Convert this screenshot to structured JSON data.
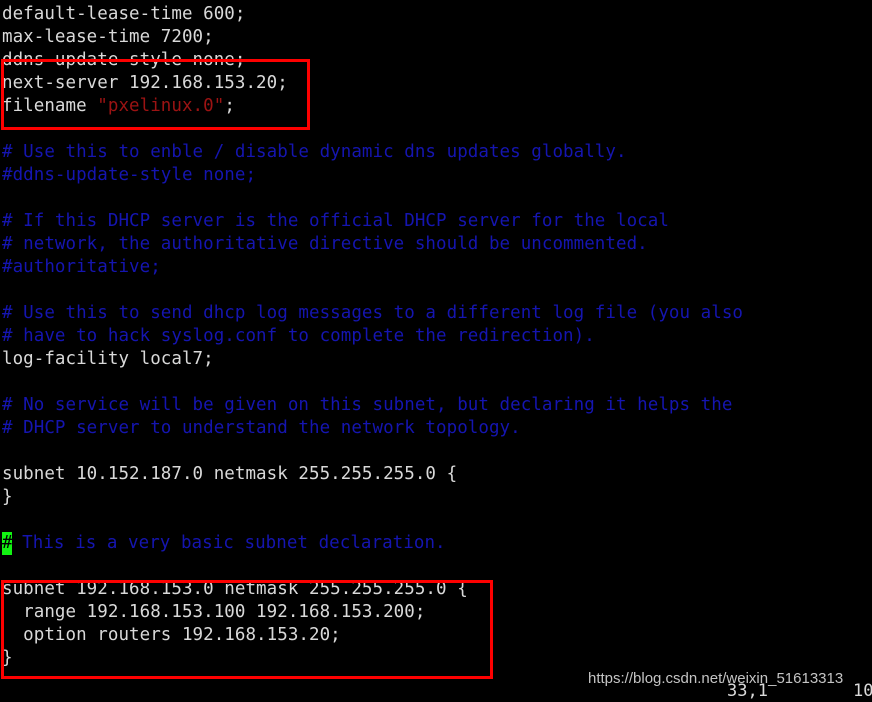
{
  "terminal": {
    "background": "#000000",
    "foreground": "#d9d9d9",
    "comment_color": "#1515b0",
    "string_color": "#9c1313",
    "cursor_color": "#12f312",
    "annotation_color": "#fe0000",
    "lines": [
      {
        "n": 1,
        "type": "code",
        "text": "default-lease-time 600;"
      },
      {
        "n": 2,
        "type": "code",
        "text": "max-lease-time 7200;"
      },
      {
        "n": 3,
        "type": "code",
        "text": "ddns-update-style none;"
      },
      {
        "n": 4,
        "type": "code",
        "text": "next-server 192.168.153.20;"
      },
      {
        "n": 5,
        "type": "mixed",
        "prefix": "filename ",
        "string": "\"pxelinux.0\"",
        "suffix": ";"
      },
      {
        "n": 6,
        "type": "blank",
        "text": ""
      },
      {
        "n": 7,
        "type": "comment",
        "text": "# Use this to enble / disable dynamic dns updates globally."
      },
      {
        "n": 8,
        "type": "comment",
        "text": "#ddns-update-style none;"
      },
      {
        "n": 9,
        "type": "blank",
        "text": ""
      },
      {
        "n": 10,
        "type": "comment",
        "text": "# If this DHCP server is the official DHCP server for the local"
      },
      {
        "n": 11,
        "type": "comment",
        "text": "# network, the authoritative directive should be uncommented."
      },
      {
        "n": 12,
        "type": "comment",
        "text": "#authoritative;"
      },
      {
        "n": 13,
        "type": "blank",
        "text": ""
      },
      {
        "n": 14,
        "type": "comment",
        "text": "# Use this to send dhcp log messages to a different log file (you also"
      },
      {
        "n": 15,
        "type": "comment",
        "text": "# have to hack syslog.conf to complete the redirection)."
      },
      {
        "n": 16,
        "type": "code",
        "text": "log-facility local7;"
      },
      {
        "n": 17,
        "type": "blank",
        "text": ""
      },
      {
        "n": 18,
        "type": "comment",
        "text": "# No service will be given on this subnet, but declaring it helps the"
      },
      {
        "n": 19,
        "type": "comment",
        "text": "# DHCP server to understand the network topology."
      },
      {
        "n": 20,
        "type": "blank",
        "text": ""
      },
      {
        "n": 21,
        "type": "code",
        "text": "subnet 10.152.187.0 netmask 255.255.255.0 {"
      },
      {
        "n": 22,
        "type": "code",
        "text": "}"
      },
      {
        "n": 23,
        "type": "blank",
        "text": ""
      },
      {
        "n": 24,
        "type": "cursor-comment",
        "cursor_char": "#",
        "rest": " This is a very basic subnet declaration."
      },
      {
        "n": 25,
        "type": "blank",
        "text": ""
      },
      {
        "n": 26,
        "type": "code",
        "text": "subnet 192.168.153.0 netmask 255.255.255.0 {"
      },
      {
        "n": 27,
        "type": "code",
        "text": "  range 192.168.153.100 192.168.153.200;"
      },
      {
        "n": 28,
        "type": "code",
        "text": "  option routers 192.168.153.20;"
      },
      {
        "n": 29,
        "type": "code",
        "text": "}"
      }
    ]
  },
  "annotations": {
    "box_top_label": "highlighted-pxe-directives",
    "box_bottom_label": "highlighted-subnet-declaration"
  },
  "status_line": {
    "position": "33,1",
    "percent": "10"
  },
  "watermark": {
    "text": "https://blog.csdn.net/weixin_51613313"
  }
}
